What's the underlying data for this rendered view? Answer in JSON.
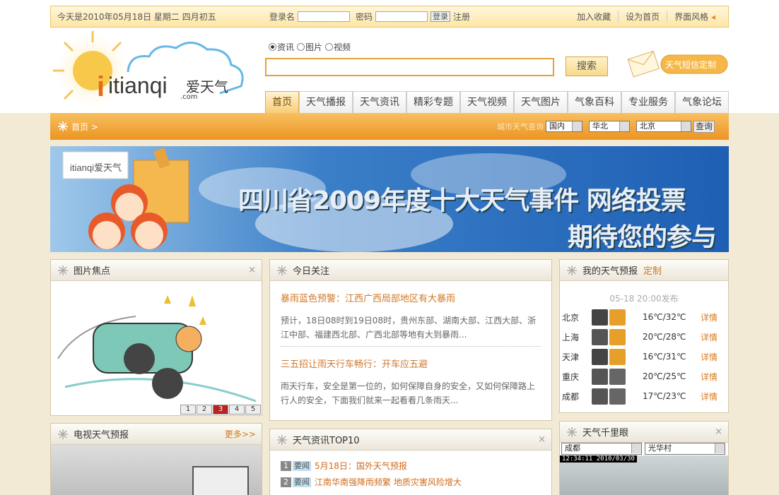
{
  "topbar": {
    "date": "今天是2010年05月18日 星期二 四月初五",
    "username_label": "登录名",
    "password_label": "密码",
    "login_button": "登录",
    "register": "注册",
    "links": [
      "加入收藏",
      "设为首页",
      "界面风格"
    ]
  },
  "logo": {
    "text": "itianqi",
    "cn": "爱天气",
    "suffix": ".com"
  },
  "search": {
    "types": [
      "资讯",
      "图片",
      "视频"
    ],
    "selected": "资讯",
    "button": "搜索",
    "sms": "天气短信定制"
  },
  "nav": [
    "首页",
    "天气播报",
    "天气资讯",
    "精彩专题",
    "天气视频",
    "天气图片",
    "气象百科",
    "专业服务",
    "气象论坛"
  ],
  "breadcrumb": {
    "home": "首页 >"
  },
  "city_query": {
    "label": "城市天气查询",
    "region1": "国内",
    "region2": "华北",
    "city": "北京",
    "button": "查询"
  },
  "banner": {
    "line1": "四川省2009年度十大天气事件 网络投票",
    "line2": "期待您的参与",
    "logo": "itianqi爱天气"
  },
  "photo_focus": {
    "title": "图片焦点",
    "close": "×",
    "pages": [
      "1",
      "2",
      "3",
      "4",
      "5"
    ],
    "current": "3"
  },
  "today": {
    "title": "今日关注",
    "close": "×",
    "items": [
      {
        "headline": "暴雨蓝色预警：江西广西局部地区有大暴雨",
        "summary": "预计，18日08时到19日08时，贵州东部、湖南大部、江西大部、浙江中部、福建西北部、广西北部等地有大到暴雨..."
      },
      {
        "headline": "三五招让雨天行车畅行：开车应五避",
        "summary": "雨天行车，安全是第一位的，如何保障自身的安全，又如何保障路上行人的安全，下面我们就来一起看看几条雨天..."
      }
    ]
  },
  "forecast": {
    "title": "我的天气预报",
    "custom": "定制",
    "published": "05-18 20:00发布",
    "rows": [
      {
        "city": "北京",
        "temp": "16℃/32℃",
        "detail": "详情",
        "icons": [
          "moon-icon",
          "sun-icon"
        ]
      },
      {
        "city": "上海",
        "temp": "20℃/28℃",
        "detail": "详情",
        "icons": [
          "rain-cloud-icon",
          "sun-cloud-icon"
        ]
      },
      {
        "city": "天津",
        "temp": "16℃/31℃",
        "detail": "详情",
        "icons": [
          "moon-icon",
          "sun-icon"
        ]
      },
      {
        "city": "重庆",
        "temp": "20℃/25℃",
        "detail": "详情",
        "icons": [
          "cloud-icon",
          "cloud-icon"
        ]
      },
      {
        "city": "成都",
        "temp": "17℃/23℃",
        "detail": "详情",
        "icons": [
          "cloud-icon",
          "cloud-icon"
        ]
      }
    ]
  },
  "tv": {
    "title": "电视天气预报",
    "more": "更多>>"
  },
  "top10": {
    "title": "天气资讯TOP10",
    "close": "×",
    "items": [
      {
        "n": "1",
        "tag": "要闻",
        "text": "5月18日：国外天气预报"
      },
      {
        "n": "2",
        "tag": "要闻",
        "text": "江南华南强降雨频繁 地质灾害风险增大"
      }
    ]
  },
  "webcam": {
    "title": "天气千里眼",
    "close": "×",
    "city": "成都",
    "spot": "光华村",
    "timestamp": "12:34:11 2010/03/30"
  }
}
